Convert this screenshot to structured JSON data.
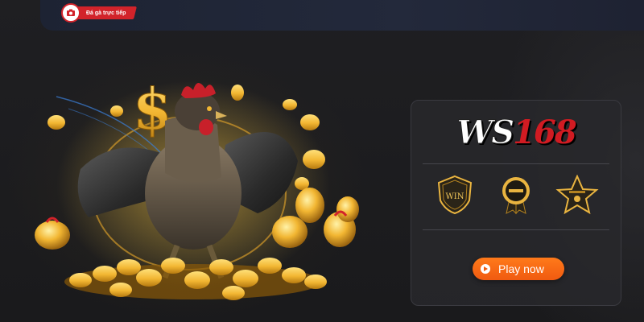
{
  "header": {
    "live_badge_label": "Đá gà trực tiếp",
    "live_badge_icon": "camera-icon"
  },
  "hero": {
    "subject": "rooster-icon",
    "decorations": [
      "gold-coin-icon",
      "dollar-sign-icon",
      "gold-egg-icon"
    ]
  },
  "panel": {
    "brand_ws": "WS",
    "brand_num": "168",
    "badges": [
      {
        "icon": "win-shield-icon",
        "text": "WIN"
      },
      {
        "icon": "guarantee-medal-icon",
        "text": ""
      },
      {
        "icon": "premium-star-icon",
        "text": ""
      }
    ],
    "play_button_label": "Play now"
  },
  "colors": {
    "accent": "#f05a10",
    "brand_red": "#d11b22",
    "gold": "#f2b632",
    "background": "#1c1c1e"
  }
}
